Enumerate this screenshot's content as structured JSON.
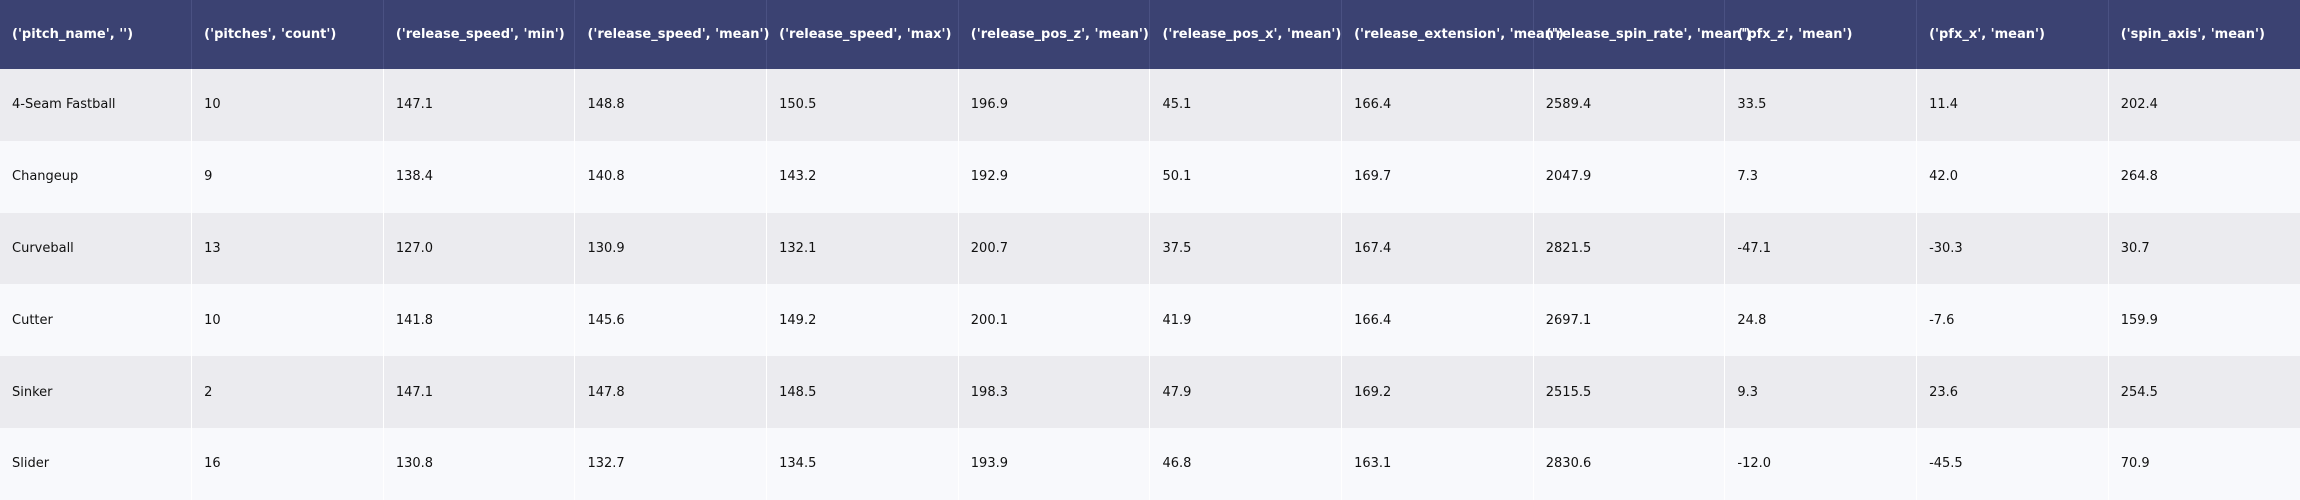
{
  "chart_data": {
    "type": "table",
    "columns": [
      "('pitch_name', '')",
      "('pitches', 'count')",
      "('release_speed', 'min')",
      "('release_speed', 'mean')",
      "('release_speed', 'max')",
      "('release_pos_z', 'mean')",
      "('release_pos_x', 'mean')",
      "('release_extension', 'mean')",
      "('release_spin_rate', 'mean')",
      "('pfx_z', 'mean')",
      "('pfx_x', 'mean')",
      "('spin_axis', 'mean')"
    ],
    "rows": [
      [
        "4-Seam Fastball",
        "10",
        "147.1",
        "148.8",
        "150.5",
        "196.9",
        "45.1",
        "166.4",
        "2589.4",
        "33.5",
        "11.4",
        "202.4"
      ],
      [
        "Changeup",
        "9",
        "138.4",
        "140.8",
        "143.2",
        "192.9",
        "50.1",
        "169.7",
        "2047.9",
        "7.3",
        "42.0",
        "264.8"
      ],
      [
        "Curveball",
        "13",
        "127.0",
        "130.9",
        "132.1",
        "200.7",
        "37.5",
        "167.4",
        "2821.5",
        "-47.1",
        "-30.3",
        "30.7"
      ],
      [
        "Cutter",
        "10",
        "141.8",
        "145.6",
        "149.2",
        "200.1",
        "41.9",
        "166.4",
        "2697.1",
        "24.8",
        "-7.6",
        "159.9"
      ],
      [
        "Sinker",
        "2",
        "147.1",
        "147.8",
        "148.5",
        "198.3",
        "47.9",
        "169.2",
        "2515.5",
        "9.3",
        "23.6",
        "254.5"
      ],
      [
        "Slider",
        "16",
        "130.8",
        "132.7",
        "134.5",
        "193.9",
        "46.8",
        "163.1",
        "2830.6",
        "-12.0",
        "-45.5",
        "70.9"
      ]
    ]
  },
  "colors": {
    "header_bg": "#3b4272",
    "header_text": "#ffffff",
    "row_odd_bg": "#ebebef",
    "row_even_bg": "#f8f9fc"
  }
}
